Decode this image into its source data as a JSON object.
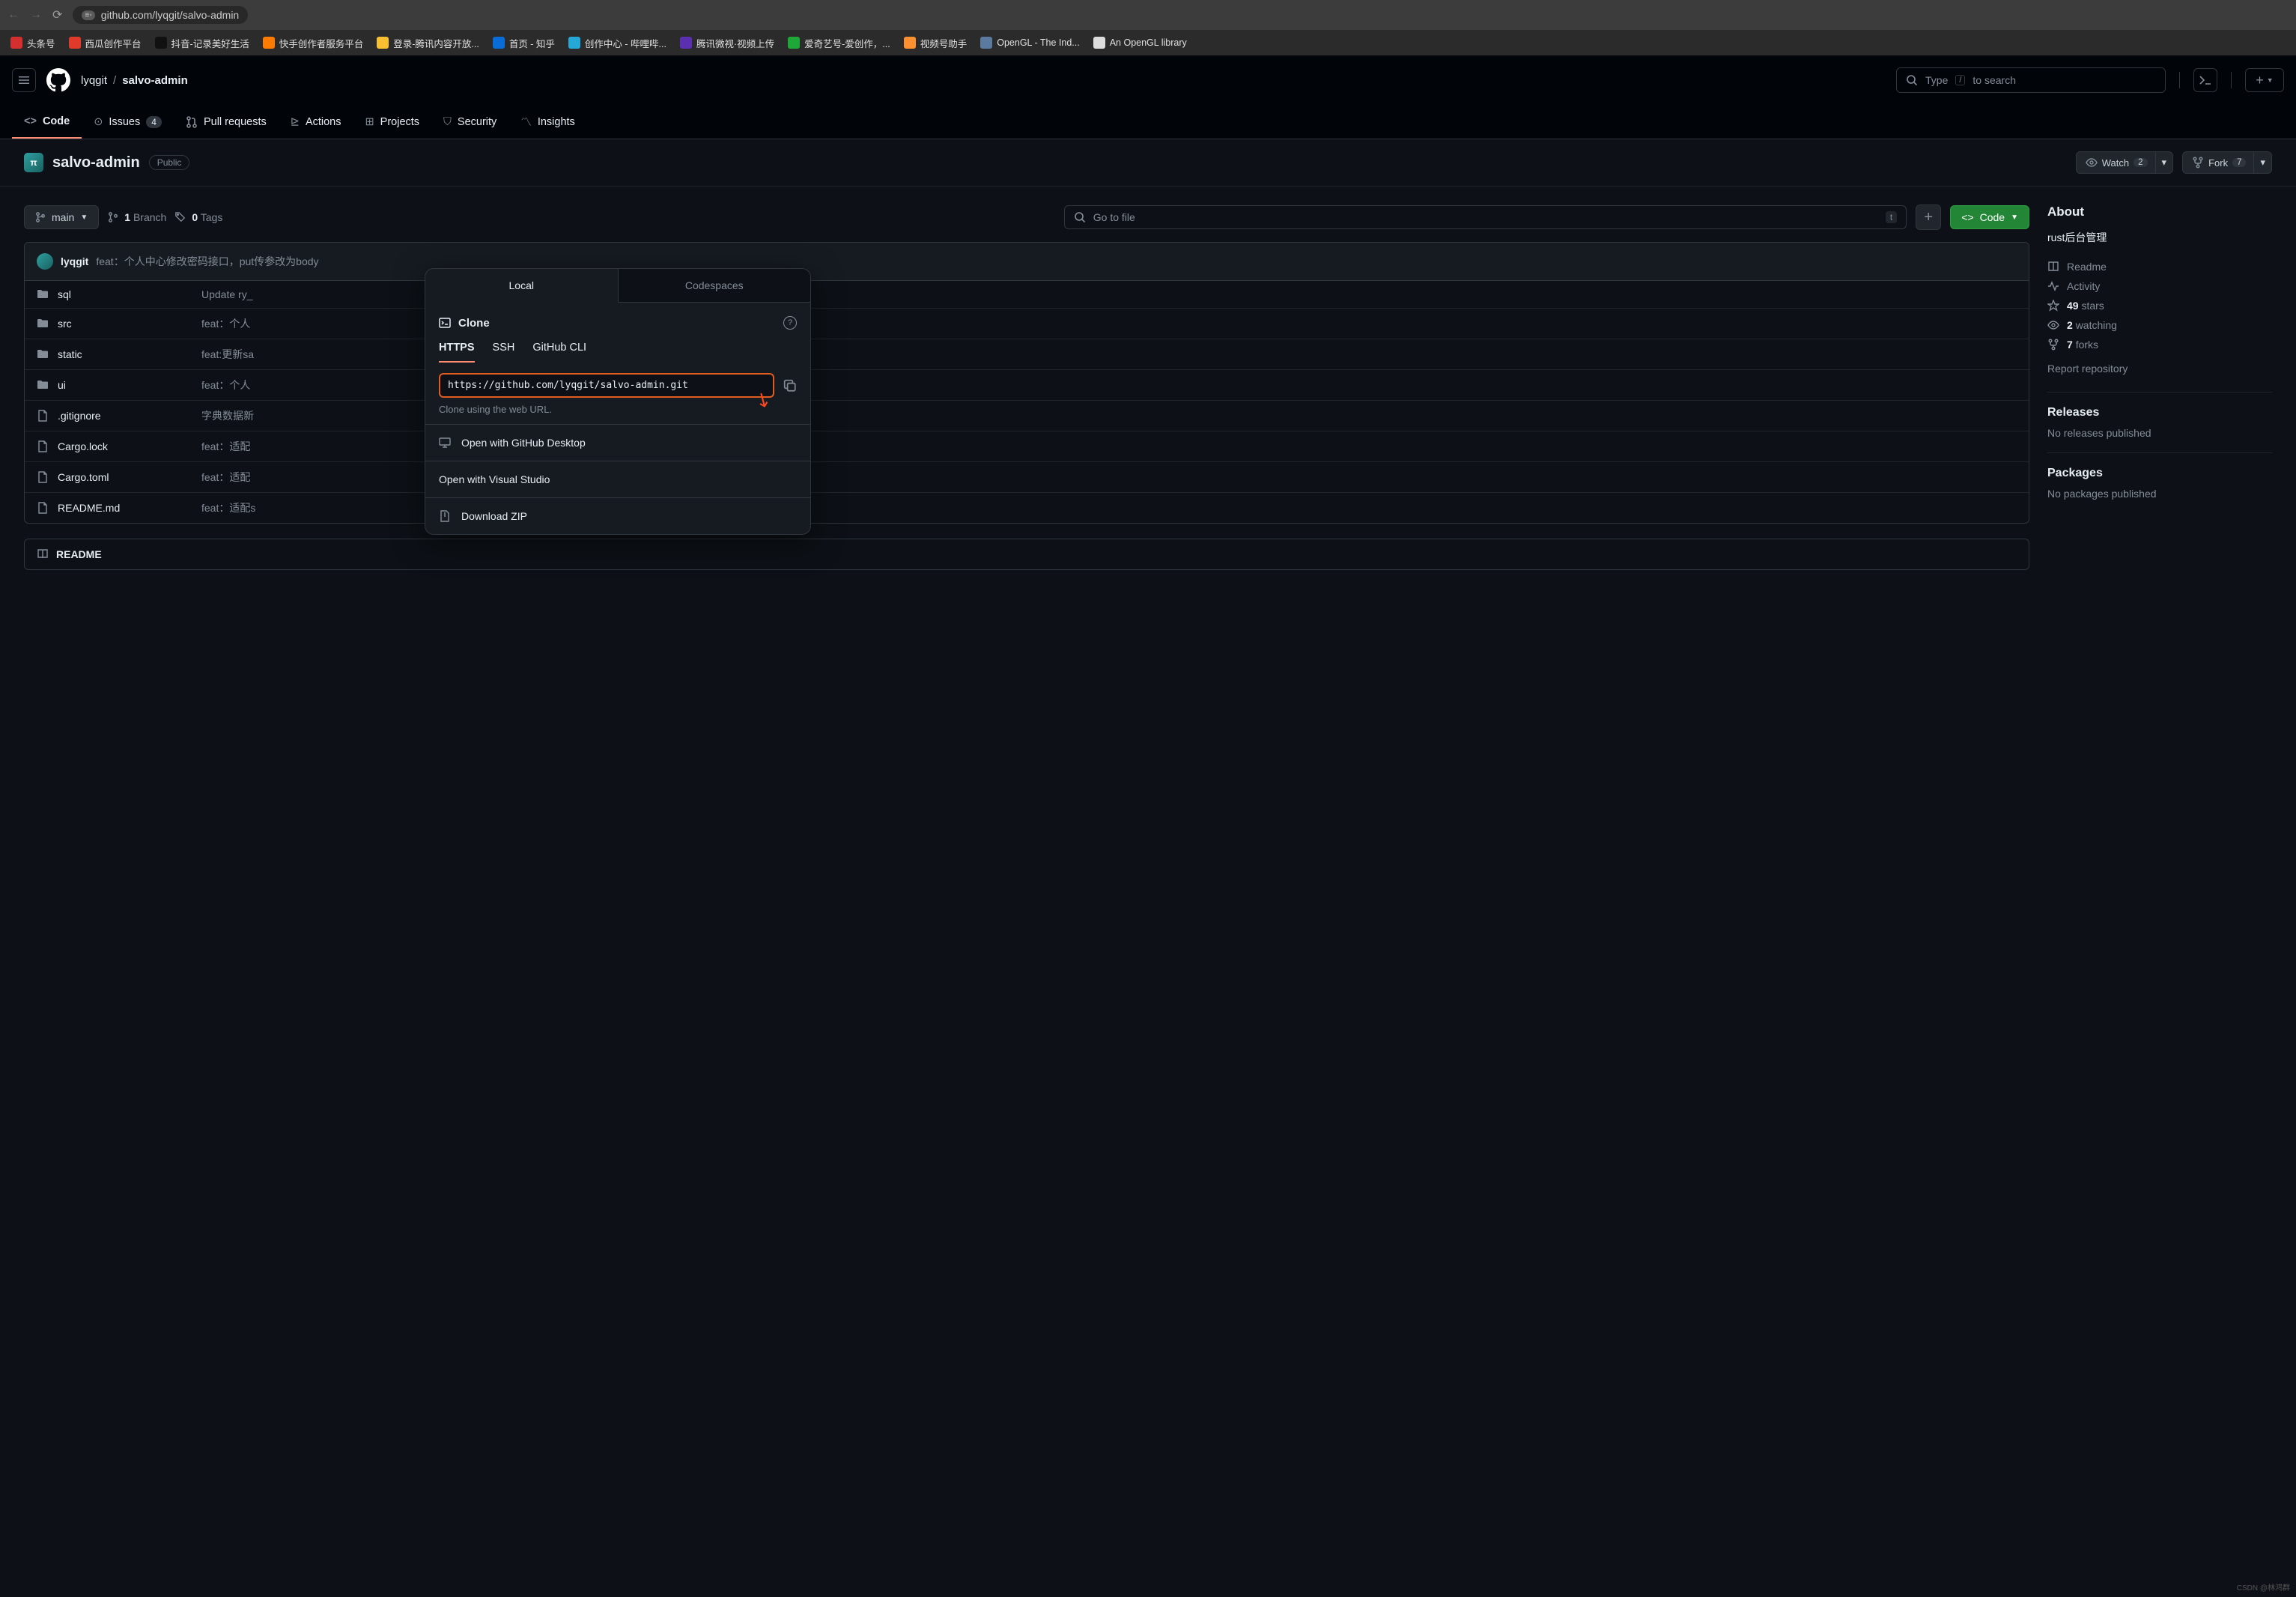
{
  "browser": {
    "url": "github.com/lyqgit/salvo-admin",
    "bookmarks": [
      {
        "label": "头条号",
        "color": "#d53030"
      },
      {
        "label": "西瓜创作平台",
        "color": "#e03a2a"
      },
      {
        "label": "抖音-记录美好生活",
        "color": "#111"
      },
      {
        "label": "快手创作者服务平台",
        "color": "#ff7b00"
      },
      {
        "label": "登录-腾讯内容开放...",
        "color": "#f8c030"
      },
      {
        "label": "首页 - 知乎",
        "color": "#0a6cd6"
      },
      {
        "label": "创作中心 - 哔哩哔...",
        "color": "#24a8d8"
      },
      {
        "label": "腾讯微视·视频上传",
        "color": "#5a30b0"
      },
      {
        "label": "爱奇艺号-爱创作，...",
        "color": "#1ea838"
      },
      {
        "label": "视频号助手",
        "color": "#ff9030"
      },
      {
        "label": "OpenGL - The Ind...",
        "color": "#5a7aa0"
      },
      {
        "label": "An OpenGL library",
        "color": "#ddd"
      }
    ]
  },
  "header": {
    "owner": "lyqgit",
    "repo": "salvo-admin",
    "search_prefix": "Type",
    "search_suffix": "to search",
    "kbd": "/"
  },
  "nav": {
    "code": "Code",
    "issues": "Issues",
    "issues_count": "4",
    "pulls": "Pull requests",
    "actions": "Actions",
    "projects": "Projects",
    "security": "Security",
    "insights": "Insights"
  },
  "repo": {
    "name": "salvo-admin",
    "badge": "Public",
    "watch": "Watch",
    "watch_count": "2",
    "fork": "Fork",
    "fork_count": "7"
  },
  "toolbar": {
    "branch": "main",
    "branches": "1",
    "branches_label": "Branch",
    "tags": "0",
    "tags_label": "Tags",
    "gotofile": "Go to file",
    "gotofile_kbd": "t",
    "code": "Code"
  },
  "commit": {
    "author": "lyqgit",
    "message": "feat：个人中心修改密码接口，put传参改为body"
  },
  "files": [
    {
      "type": "dir",
      "name": "sql",
      "msg": "Update ry_"
    },
    {
      "type": "dir",
      "name": "src",
      "msg": "feat：个人"
    },
    {
      "type": "dir",
      "name": "static",
      "msg": "feat:更新sa"
    },
    {
      "type": "dir",
      "name": "ui",
      "msg": "feat：个人"
    },
    {
      "type": "file",
      "name": ".gitignore",
      "msg": "字典数据新"
    },
    {
      "type": "file",
      "name": "Cargo.lock",
      "msg": "feat：适配"
    },
    {
      "type": "file",
      "name": "Cargo.toml",
      "msg": "feat：适配"
    },
    {
      "type": "file",
      "name": "README.md",
      "msg": "feat：适配s"
    }
  ],
  "readme": {
    "label": "README"
  },
  "popup": {
    "tab_local": "Local",
    "tab_codespaces": "Codespaces",
    "clone": "Clone",
    "https": "HTTPS",
    "ssh": "SSH",
    "cli": "GitHub CLI",
    "url": "https://github.com/lyqgit/salvo-admin.git",
    "hint": "Clone using the web URL.",
    "desktop": "Open with GitHub Desktop",
    "vs": "Open with Visual Studio",
    "zip": "Download ZIP"
  },
  "sidebar": {
    "about": "About",
    "description": "rust后台管理",
    "readme": "Readme",
    "activity": "Activity",
    "stars_n": "49",
    "stars": "stars",
    "watching_n": "2",
    "watching": "watching",
    "forks_n": "7",
    "forks": "forks",
    "report": "Report repository",
    "releases": "Releases",
    "releases_empty": "No releases published",
    "packages": "Packages",
    "packages_empty": "No packages published"
  },
  "watermark": "CSDN @林鸿群"
}
